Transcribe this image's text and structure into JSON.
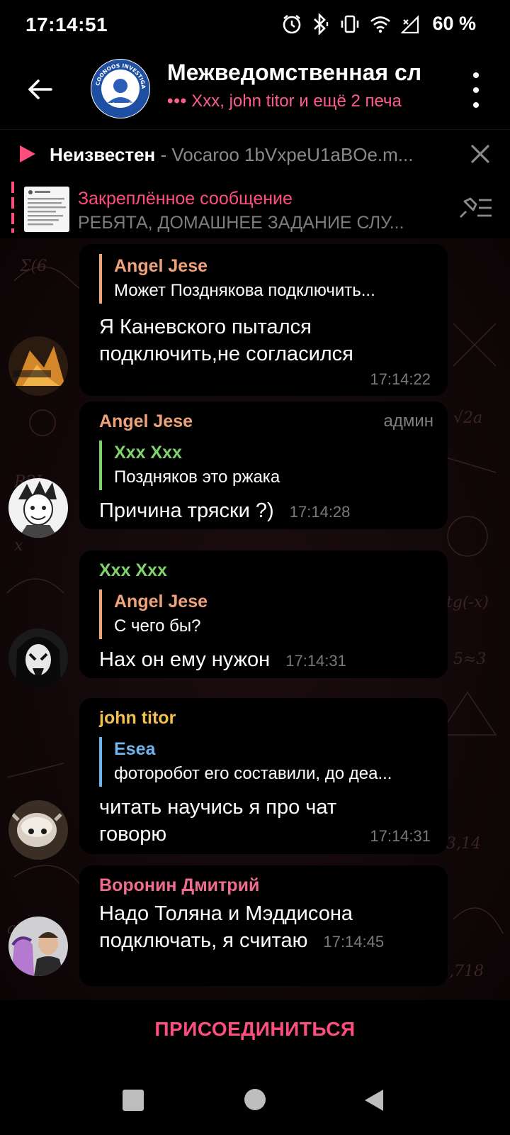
{
  "status_bar": {
    "time": "17:14:51",
    "battery": "60 %",
    "icons": [
      "alarm-icon",
      "bluetooth-icon",
      "vibrate-icon",
      "wifi-icon",
      "signal-off-icon"
    ]
  },
  "header": {
    "title": "Межведомственная сл",
    "subtitle_dots": "•••",
    "subtitle": "Xxx, john titor и ещё 2 печа",
    "avatar_text_top": "COONOOS INVESTIGATE GROUP",
    "avatar_text_bottom": "20 kartikov"
  },
  "player": {
    "artist": "Неизвестен",
    "separator": " - ",
    "track": "Vocaroo 1bVxpeU1aBOe.m..."
  },
  "pinned": {
    "title": "Закреплённое сообщение",
    "text": "РЕБЯТА, ДОМАШНЕЕ ЗАДАНИЕ СЛУ..."
  },
  "messages": [
    {
      "sender": "",
      "admin": "",
      "reply_name": "Angel Jese",
      "reply_text": "Может Позднякова подключить...",
      "reply_color": "#f0a27a",
      "text_line1": "Я Каневского пытался",
      "text_line2": "подключить,не согласился",
      "time": "17:14:22"
    },
    {
      "sender": "Angel Jese",
      "sender_color": "#f0a27a",
      "admin": "админ",
      "reply_name": "Xxx Xxx",
      "reply_text": "Поздняков это ржака",
      "reply_color": "#7ed36a",
      "text_line1": "Причина тряски ?)",
      "time": "17:14:28"
    },
    {
      "sender": "Xxx Xxx",
      "sender_color": "#7ed36a",
      "reply_name": "Angel Jese",
      "reply_text": "С чего бы?",
      "reply_color": "#f0a27a",
      "text_line1": "Нах он ему нужон",
      "time": "17:14:31"
    },
    {
      "sender": "john titor",
      "sender_color": "#f3c04f",
      "reply_name": "Esea",
      "reply_text": "фоторобот его составили, до деа...",
      "reply_color": "#6fb4ee",
      "text_line1": "читать научись я про чат",
      "text_line2": "говорю",
      "time": "17:14:31"
    },
    {
      "sender": "Воронин Дмитрий",
      "sender_color": "#f06c8f",
      "text_line1": "Надо Толяна и Мэддисона",
      "text_line2": "подключать, я считаю",
      "time": "17:14:45"
    }
  ],
  "join": {
    "label": "ПРИСОЕДИНИТЬСЯ"
  },
  "colors": {
    "accent": "#ff4d7d",
    "background": "#000000"
  }
}
